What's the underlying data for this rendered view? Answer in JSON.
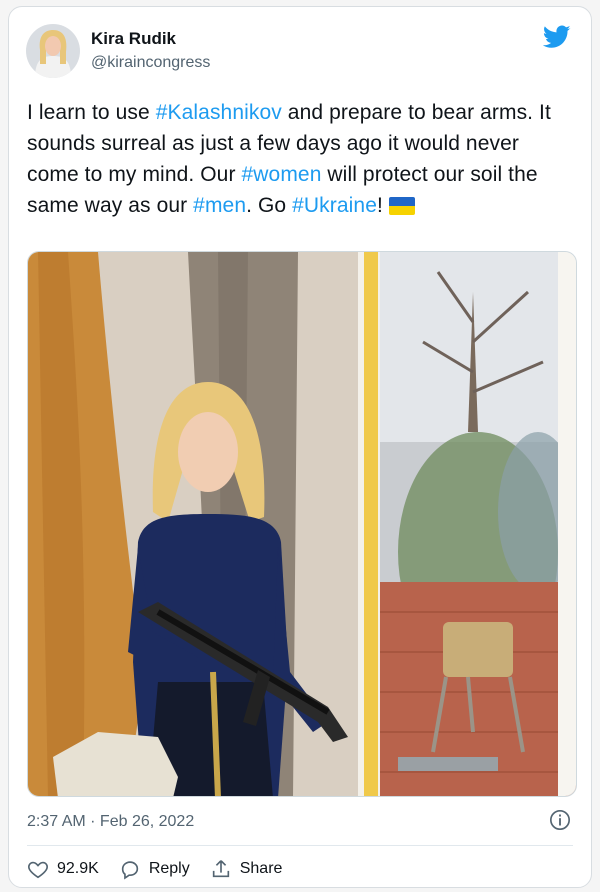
{
  "author": {
    "name": "Kira Rudik",
    "handle": "@kiraincongress"
  },
  "tweet": {
    "segments": [
      {
        "type": "text",
        "value": "I learn to use "
      },
      {
        "type": "hashtag",
        "value": "#Kalashnikov"
      },
      {
        "type": "text",
        "value": " and prepare to bear arms. It sounds surreal as just a few days ago it would never come to my mind. Our "
      },
      {
        "type": "hashtag",
        "value": "#women"
      },
      {
        "type": "text",
        "value": " will protect our soil the same way as our "
      },
      {
        "type": "hashtag",
        "value": "#men"
      },
      {
        "type": "text",
        "value": ". Go "
      },
      {
        "type": "hashtag",
        "value": "#Ukraine"
      },
      {
        "type": "text",
        "value": "!"
      }
    ],
    "flag_colors": [
      "#1f66c7",
      "#f6d200"
    ]
  },
  "timestamp": "2:37 AM · Feb 26, 2022",
  "actions": {
    "like_count": "92.9K",
    "reply_label": "Reply",
    "share_label": "Share"
  },
  "colors": {
    "hashtag": "#1d9bf0",
    "twitter_blue": "#1d9bf0",
    "secondary_text": "#536471"
  },
  "icons": [
    "twitter-bird-icon",
    "info-icon",
    "heart-icon",
    "reply-icon",
    "share-icon"
  ]
}
